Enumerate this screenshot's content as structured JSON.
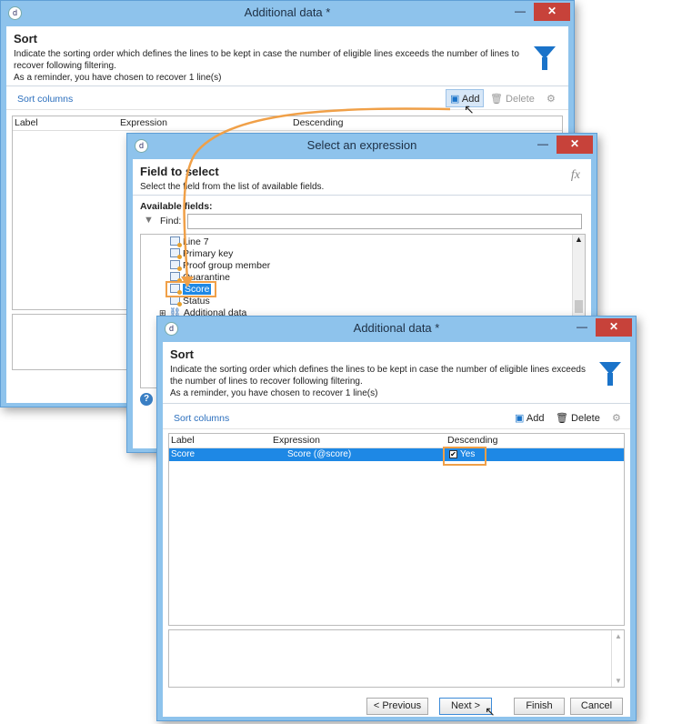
{
  "win1": {
    "title": "Additional data *",
    "minimize": "—",
    "close": "✕",
    "heading": "Sort",
    "desc_line1": "Indicate the sorting order which defines the lines to be kept in case the number of eligible lines exceeds the number of lines to",
    "desc_line2": "recover following filtering.",
    "desc_line3": "As a reminder, you have chosen to recover 1 line(s)",
    "sort_columns": "Sort columns",
    "add": "Add",
    "delete": "Delete",
    "col_label": "Label",
    "col_expression": "Expression",
    "col_descending": "Descending"
  },
  "win2": {
    "title": "Select an expression",
    "minimize": "—",
    "close": "✕",
    "heading": "Field to select",
    "desc": "Select the field from the list of available fields.",
    "fx": "fx",
    "available_fields": "Available fields:",
    "find_label": "Find:",
    "find_value": "",
    "tree": [
      "Line 7",
      "Primary key",
      "Proof group member",
      "Quarantine",
      "Score",
      "Status",
      "Additional data"
    ],
    "help": "?"
  },
  "win3": {
    "title": "Additional data *",
    "minimize": "—",
    "close": "✕",
    "heading": "Sort",
    "desc_line1": "Indicate the sorting order which defines the lines to be kept in case the number of eligible lines exceeds",
    "desc_line2": "the number of lines to recover following filtering.",
    "desc_line3": "As a reminder, you have chosen to recover 1 line(s)",
    "sort_columns": "Sort columns",
    "add": "Add",
    "delete": "Delete",
    "col_label": "Label",
    "col_expression": "Expression",
    "col_descending": "Descending",
    "row": {
      "label": "Score",
      "expression": "Score (@score)",
      "descending": "Yes"
    },
    "btn_previous": "< Previous",
    "btn_next": "Next >",
    "btn_finish": "Finish",
    "btn_cancel": "Cancel"
  },
  "colors": {
    "accent": "#1e88e5",
    "highlight": "#f0a048",
    "titlebar": "#8ec3ec",
    "close": "#c7423a"
  }
}
